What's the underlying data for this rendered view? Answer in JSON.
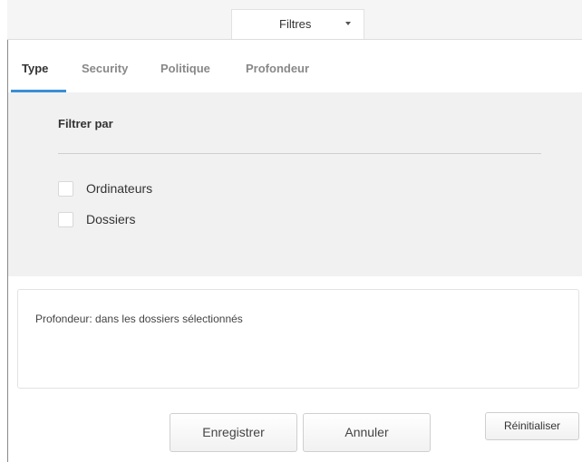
{
  "header": {
    "dropdown_label": "Filtres"
  },
  "tabs": [
    {
      "label": "Type",
      "active": true
    },
    {
      "label": "Security",
      "active": false
    },
    {
      "label": "Politique",
      "active": false
    },
    {
      "label": "Profondeur",
      "active": false
    }
  ],
  "filter": {
    "title": "Filtrer par",
    "options": [
      {
        "label": "Ordinateurs",
        "checked": false
      },
      {
        "label": "Dossiers",
        "checked": false
      }
    ]
  },
  "info": {
    "text": "Profondeur: dans les dossiers sélectionnés"
  },
  "buttons": {
    "save": "Enregistrer",
    "cancel": "Annuler",
    "reset": "Réinitialiser"
  },
  "colors": {
    "accent": "#3a8fd6",
    "panel_bg": "#f1f1f1"
  },
  "icons": {
    "dropdown": "caret-down-icon",
    "checkbox": "checkbox-unchecked-icon"
  }
}
